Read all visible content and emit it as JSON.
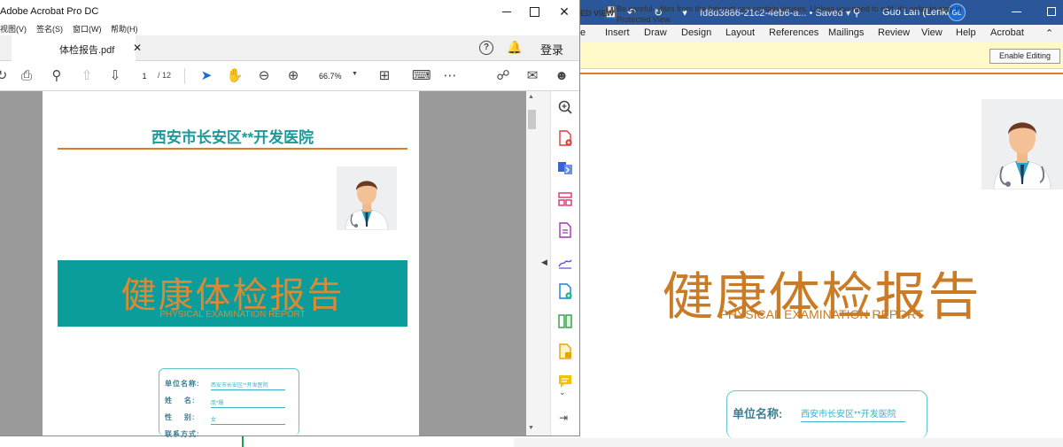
{
  "word": {
    "doc_name": "fd8d3886-21c2-4eb6-a...",
    "save_status": "Saved",
    "user_name": "Guo Lan (Lenka)",
    "avatar_initials": "GL",
    "ribbon_tabs": [
      "e",
      "Insert",
      "Draw",
      "Design",
      "Layout",
      "References",
      "Mailings",
      "Review",
      "View",
      "Help",
      "Acrobat"
    ],
    "protected_view_title": "ED VIEW",
    "protected_view_message": "Be careful—files from the Internet can contain viruses. Unless you need to edit, it's safer to stay in Protected View.",
    "enable_editing_label": "Enable Editing",
    "report_title_cn": "健康体检报告",
    "report_title_en": "PHYSICAL EXAMINATION REPORT",
    "card_label": "单位名称:",
    "card_value": "西安市长安区**开发医院"
  },
  "acrobat": {
    "window_title": "Adobe Acrobat Pro DC",
    "menus": [
      "视图(V)",
      "签名(S)",
      "窗口(W)",
      "帮助(H)"
    ],
    "tab_label": "体检报告.pdf",
    "login_label": "登录",
    "page_current": "1",
    "page_total": "/ 12",
    "zoom_level": "66.7%",
    "pdf": {
      "hospital_name": "西安市长安区**开发医院",
      "banner_cn": "健康体检报告",
      "banner_en": "PHYSICAL EXAMINATION REPORT",
      "fields": [
        {
          "label": "单位名称:",
          "value": "西安市长安区**开发医院"
        },
        {
          "label": "姓    名:",
          "value": "庞*珊"
        },
        {
          "label": "性    别:",
          "value": "女"
        },
        {
          "label": "联系方式:",
          "value": ""
        }
      ]
    }
  },
  "colors": {
    "word_blue": "#2b579a",
    "teal": "#0b9d9b",
    "orange": "#d98a35",
    "accent_rule": "#e07b2a"
  }
}
